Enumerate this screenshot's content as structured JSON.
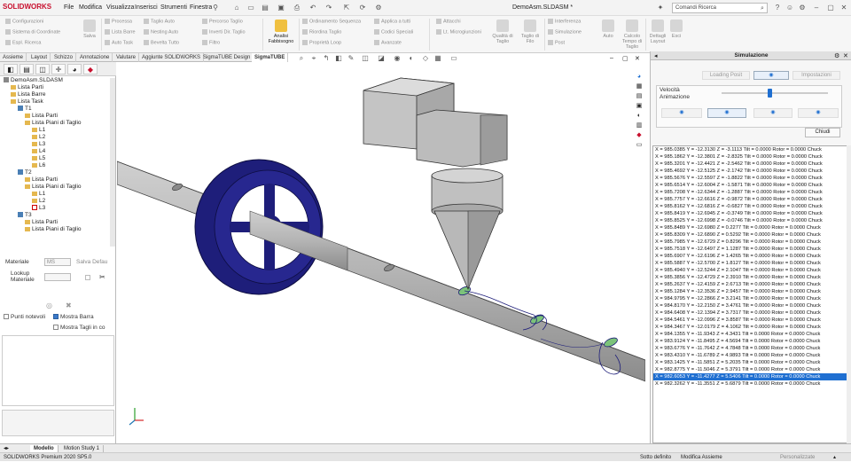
{
  "app": {
    "logo_text": "SOLIDWORKS",
    "doc_title": "DemoAsm.SLDASM *"
  },
  "menu": [
    "File",
    "Modifica",
    "Visualizza",
    "Inserisci",
    "Strumenti",
    "Finestra"
  ],
  "search": {
    "placeholder": "Comandi Ricerca"
  },
  "ribbon": {
    "col1": [
      "Configurazioni",
      "Sistema di Coordinate",
      "Espl. Ricerca"
    ],
    "col2_btn": "Salva",
    "col3": [
      "Processa",
      "Lista Barre",
      "Auto Task"
    ],
    "col4": [
      "Taglio Auto",
      "Nesting Auto",
      "Bevelta Tutto"
    ],
    "col5": [
      "Percorso Taglio",
      "Inverti Dir. Taglio",
      "Filtro"
    ],
    "analisi": "Analisi Fabbisogno",
    "col6": [
      "Ordinamento Sequenza",
      "Riordina Taglio",
      "Proprietà Loop"
    ],
    "col7": [
      "Applica a tutti",
      "Codici Speciali",
      "Avanzate"
    ],
    "col8": [
      "Attacchi",
      "Lt. Microgiunzioni"
    ],
    "qualita": "Qualità di Taglio",
    "taglio_filo": "Taglio di Filo",
    "col9": [
      "Interferenza",
      "Simulazione",
      "Post"
    ],
    "auto": "Auto",
    "calcolo": "Calcolo Tempo di Taglio",
    "dettagli": "Dettagli Layout",
    "esci": "Esci"
  },
  "cmd_tabs": [
    "Assieme",
    "Layout",
    "Schizzo",
    "Annotazione",
    "Valutare",
    "Aggiunte SOLIDWORKS",
    "SigmaTUBE Design",
    "SigmaTUBE"
  ],
  "tree": [
    {
      "label": "DemoAsm.SLDASM",
      "level": 0,
      "icon": "assembly"
    },
    {
      "label": "Lista Parti",
      "level": 1,
      "icon": "folder"
    },
    {
      "label": "Lista Barre",
      "level": 1,
      "icon": "folder"
    },
    {
      "label": "Lista Task",
      "level": 1,
      "icon": "folder"
    },
    {
      "label": "T1",
      "level": 2,
      "icon": "bar"
    },
    {
      "label": "Lista Parti",
      "level": 3,
      "icon": "folder"
    },
    {
      "label": "Lista Piani di Taglio",
      "level": 3,
      "icon": "folder"
    },
    {
      "label": "L1",
      "level": 4,
      "icon": "folder"
    },
    {
      "label": "L2",
      "level": 4,
      "icon": "folder"
    },
    {
      "label": "L3",
      "level": 4,
      "icon": "folder"
    },
    {
      "label": "L4",
      "level": 4,
      "icon": "folder"
    },
    {
      "label": "L5",
      "level": 4,
      "icon": "folder"
    },
    {
      "label": "L6",
      "level": 4,
      "icon": "folder"
    },
    {
      "label": "T2",
      "level": 2,
      "icon": "bar"
    },
    {
      "label": "Lista Parti",
      "level": 3,
      "icon": "folder"
    },
    {
      "label": "Lista Piani di Taglio",
      "level": 3,
      "icon": "folder"
    },
    {
      "label": "L1",
      "level": 4,
      "icon": "folder"
    },
    {
      "label": "L2",
      "level": 4,
      "icon": "folder"
    },
    {
      "label": "L3",
      "level": 4,
      "icon": "red"
    },
    {
      "label": "T3",
      "level": 2,
      "icon": "bar"
    },
    {
      "label": "Lista Parti",
      "level": 3,
      "icon": "folder"
    },
    {
      "label": "Lista Piani di Taglio",
      "level": 3,
      "icon": "folder"
    }
  ],
  "props": {
    "materiale_label": "Materiale",
    "materiale_value": "MS",
    "salva_default": "Salva Defau",
    "lookup_label": "Lookup Materiale",
    "punti_notevoli": "Punti notevoli",
    "mostra_barra": "Mostra Barra",
    "mostra_tagli": "Mostra Tagli in co"
  },
  "sim": {
    "title": "Simulazione",
    "loading": "Loading Posit",
    "impostazioni": "Impostazioni",
    "velocita": "Velocità",
    "animazione": "Animazione",
    "slider_fraction": 0.45,
    "chiudi": "Chiudi",
    "rows": [
      "X = 985.0385  Y = -12.3130  Z = -3.1113  Tilt = 0.0000  Rotor = 0.0000  Chuck",
      "X = 985.1862  Y = -12.3801  Z = -2.8325  Tilt = 0.0000  Rotor = 0.0000  Chuck",
      "X = 985.3201  Y = -12.4421  Z = -2.5462  Tilt = 0.0000  Rotor = 0.0000  Chuck",
      "X = 985.4692  Y = -12.5125  Z = -2.1742  Tilt = 0.0000  Rotor = 0.0000  Chuck",
      "X = 985.5676  Y = -12.5597  Z = -1.8822  Tilt = 0.0000  Rotor = 0.0000  Chuck",
      "X = 985.6514  Y = -12.6004  Z = -1.5871  Tilt = 0.0000  Rotor = 0.0000  Chuck",
      "X = 985.7208  Y = -12.6344  Z = -1.2887  Tilt = 0.0000  Rotor = 0.0000  Chuck",
      "X = 985.7757  Y = -12.6616  Z = -0.9872  Tilt = 0.0000  Rotor = 0.0000  Chuck",
      "X = 985.8162  Y = -12.6816  Z = -0.6827  Tilt = 0.0000  Rotor = 0.0000  Chuck",
      "X = 985.8419  Y = -12.6945  Z = -0.3749  Tilt = 0.0000  Rotor = 0.0000  Chuck",
      "X = 985.8525  Y = -12.6998  Z = -0.0746  Tilt = 0.0000  Rotor = 0.0000  Chuck",
      "X = 985.8489  Y = -12.6980  Z = 0.2277  Tilt = 0.0000  Rotor = 0.0000  Chuck",
      "X = 985.8309  Y = -12.6890  Z = 0.5292  Tilt = 0.0000  Rotor = 0.0000  Chuck",
      "X = 985.7985  Y = -12.6729  Z = 0.8296  Tilt = 0.0000  Rotor = 0.0000  Chuck",
      "X = 985.7518  Y = -12.6497  Z = 1.1287  Tilt = 0.0000  Rotor = 0.0000  Chuck",
      "X = 985.6907  Y = -12.6196  Z = 1.4265  Tilt = 0.0000  Rotor = 0.0000  Chuck",
      "X = 985.5887  Y = -12.5700  Z = 1.8127  Tilt = 0.0000  Rotor = 0.0000  Chuck",
      "X = 985.4940  Y = -12.5244  Z = 2.1047  Tilt = 0.0000  Rotor = 0.0000  Chuck",
      "X = 985.3856  Y = -12.4729  Z = 2.3910  Tilt = 0.0000  Rotor = 0.0000  Chuck",
      "X = 985.2637  Y = -12.4159  Z = 2.6713  Tilt = 0.0000  Rotor = 0.0000  Chuck",
      "X = 985.1284  Y = -12.3536  Z = 2.9457  Tilt = 0.0000  Rotor = 0.0000  Chuck",
      "X = 984.9795  Y = -12.2866  Z = 3.2141  Tilt = 0.0000  Rotor = 0.0000  Chuck",
      "X = 984.8170  Y = -12.2150  Z = 3.4761  Tilt = 0.0000  Rotor = 0.0000  Chuck",
      "X = 984.6408  Y = -12.1394  Z = 3.7317  Tilt = 0.0000  Rotor = 0.0000  Chuck",
      "X = 984.5461  Y = -12.0996  Z = 3.8587  Tilt = 0.0000  Rotor = 0.0000  Chuck",
      "X = 984.3467  Y = -12.0179  Z = 4.1062  Tilt = 0.0000  Rotor = 0.0000  Chuck",
      "X = 984.1355  Y = -11.9343  Z = 4.3431  Tilt = 0.0000  Rotor = 0.0000  Chuck",
      "X = 983.9124  Y = -11.8495  Z = 4.5694  Tilt = 0.0000  Rotor = 0.0000  Chuck",
      "X = 983.6776  Y = -11.7642  Z = 4.7848  Tilt = 0.0000  Rotor = 0.0000  Chuck",
      "X = 983.4310  Y = -11.6789  Z = 4.9893  Tilt = 0.0000  Rotor = 0.0000  Chuck",
      "X = 983.1425  Y = -11.5851  Z = 5.2035  Tilt = 0.0000  Rotor = 0.0000  Chuck",
      "X = 982.8775  Y = -11.5046  Z = 5.3791  Tilt = 0.0000  Rotor = 0.0000  Chuck",
      "X = 982.6053  Y = -11.4277  Z = 5.5406  Tilt = 0.0000  Rotor = 0.0000  Chuck",
      "X = 982.3262  Y = -11.3551  Z = 5.6879  Tilt = 0.0000  Rotor = 0.0000  Chuck"
    ],
    "selected_row": 32
  },
  "bottom_tabs": [
    "Modello",
    "Motion Study 1"
  ],
  "status": {
    "left": "SOLIDWORKS Premium 2020 SP5.0",
    "mid1": "Sotto definito",
    "mid2": "Modifica Assieme",
    "right": "Personalizzate"
  },
  "colors": {
    "accent": "#1f6fd1",
    "brand": "#c8102e",
    "wheel": "#1e1e7a",
    "tube": "#b4b4b4",
    "head": "#bdbdbd"
  }
}
